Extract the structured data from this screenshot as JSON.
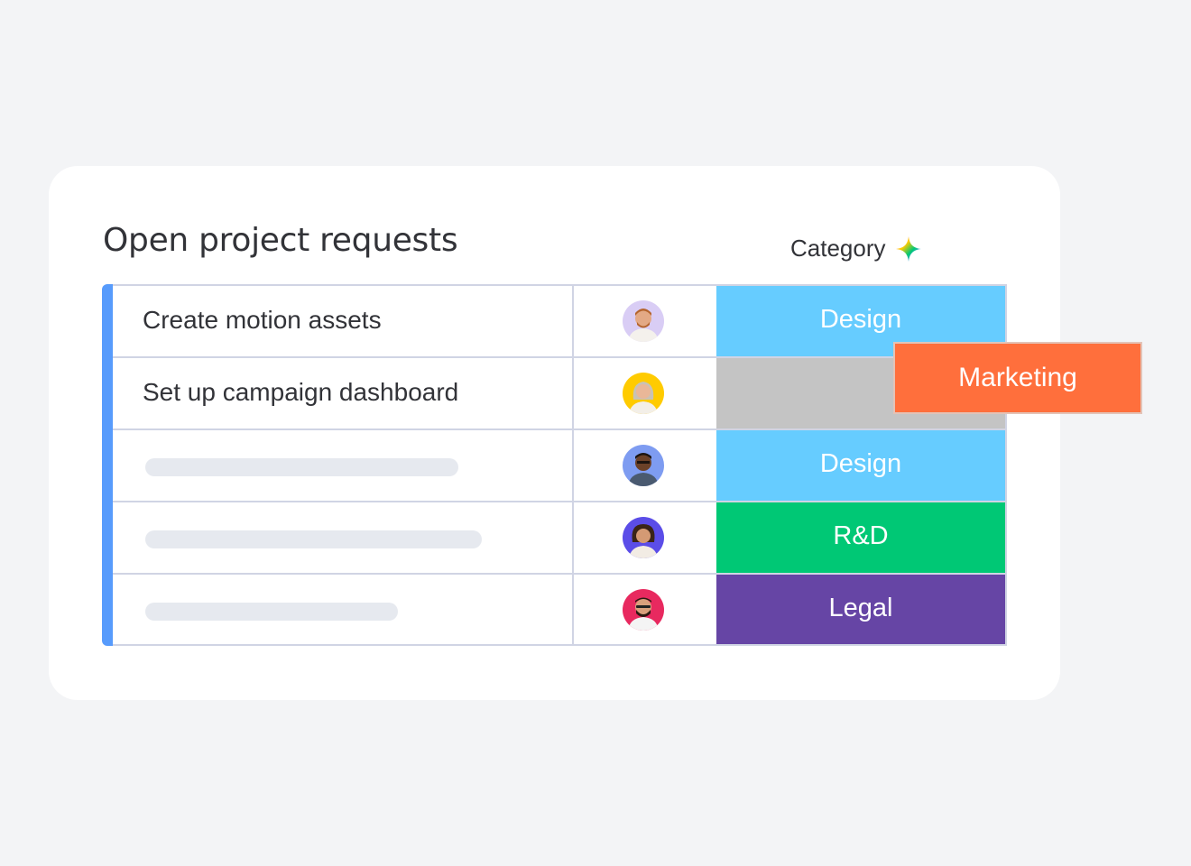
{
  "board": {
    "title": "Open project requests",
    "category_header": "Category",
    "group_color": "#579bfc"
  },
  "rows": [
    {
      "name": "Create motion assets",
      "avatar": "person-avatar",
      "avatar_bg": "#d9cdf5",
      "category": "Design",
      "category_color": "#66ccff"
    },
    {
      "name": "Set up campaign dashboard",
      "avatar": "person-avatar",
      "avatar_bg": "#ffcb00",
      "category": "",
      "category_color": "#c4c4c4"
    },
    {
      "name": "",
      "avatar": "person-avatar",
      "avatar_bg": "#7e9cf1",
      "category": "Design",
      "category_color": "#66ccff"
    },
    {
      "name": "",
      "avatar": "person-avatar",
      "avatar_bg": "#5b4de8",
      "category": "R&D",
      "category_color": "#00c875"
    },
    {
      "name": "",
      "avatar": "person-avatar",
      "avatar_bg": "#e8295f",
      "category": "Legal",
      "category_color": "#6645a5"
    }
  ],
  "dropdown_option": {
    "label": "Marketing",
    "color": "#ff6f3c"
  },
  "icons": {
    "ai_sparkle": "sparkle-icon"
  }
}
